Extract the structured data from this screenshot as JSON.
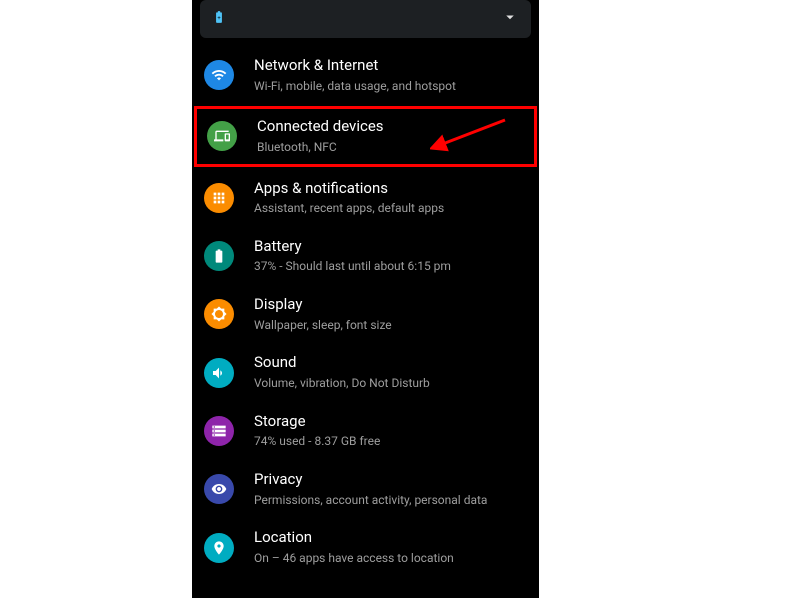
{
  "settings": {
    "items": [
      {
        "title": "Network & Internet",
        "subtitle": "Wi-Fi, mobile, data usage, and hotspot"
      },
      {
        "title": "Connected devices",
        "subtitle": "Bluetooth, NFC"
      },
      {
        "title": "Apps & notifications",
        "subtitle": "Assistant, recent apps, default apps"
      },
      {
        "title": "Battery",
        "subtitle": "37% - Should last until about 6:15 pm"
      },
      {
        "title": "Display",
        "subtitle": "Wallpaper, sleep, font size"
      },
      {
        "title": "Sound",
        "subtitle": "Volume, vibration, Do Not Disturb"
      },
      {
        "title": "Storage",
        "subtitle": "74% used - 8.37 GB free"
      },
      {
        "title": "Privacy",
        "subtitle": "Permissions, account activity, personal data"
      },
      {
        "title": "Location",
        "subtitle": "On – 46 apps have access to location"
      }
    ]
  }
}
